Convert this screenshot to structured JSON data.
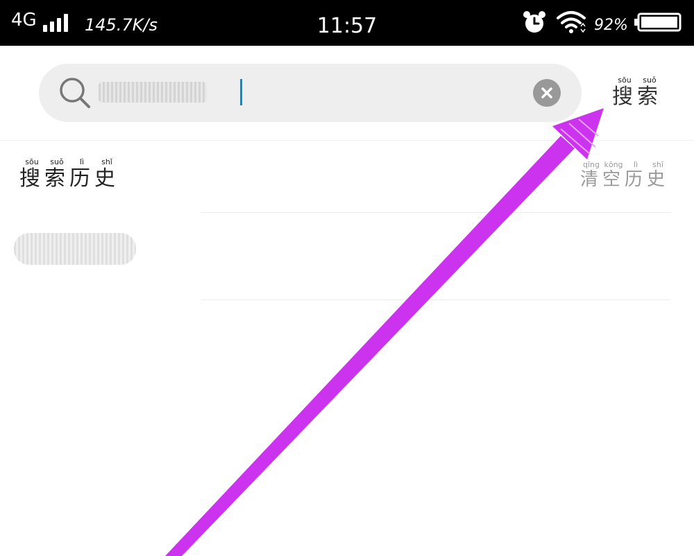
{
  "status_bar": {
    "network": "4G",
    "speed": "145.7K/s",
    "time": "11:57",
    "battery_percent": "92%"
  },
  "search": {
    "query": "103337777",
    "clear_icon": "close-icon",
    "search_icon": "search-icon"
  },
  "search_button": {
    "pinyin": [
      "sōu",
      "suǒ"
    ],
    "chars": [
      "搜",
      "索"
    ]
  },
  "history": {
    "title_pinyin": [
      "sōu",
      "suǒ",
      "lì",
      "shǐ"
    ],
    "title_chars": [
      "搜",
      "索",
      "历",
      "史"
    ],
    "clear_pinyin": [
      "qīng",
      "kōng",
      "lì",
      "shǐ"
    ],
    "clear_chars": [
      "清",
      "空",
      "历",
      "史"
    ],
    "items": [
      {
        "label": "103337777"
      }
    ]
  },
  "colors": {
    "annotation_arrow": "#cc33ee",
    "search_bar_bg": "#eeeeee",
    "status_bar_bg": "#000000"
  }
}
